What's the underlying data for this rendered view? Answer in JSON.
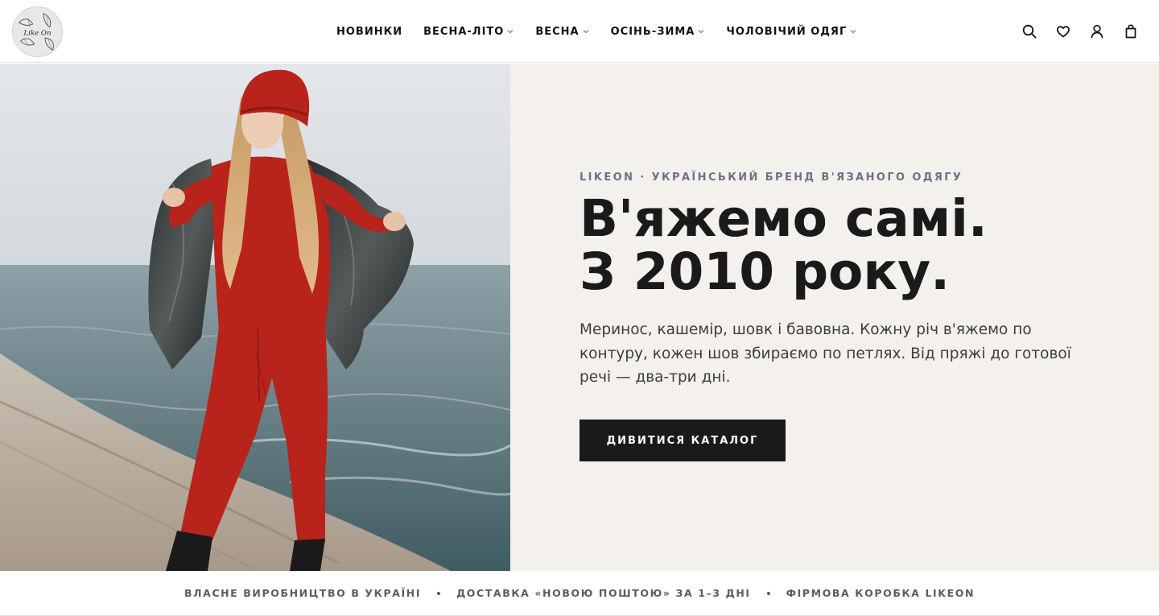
{
  "header": {
    "logo_text": "Like On",
    "nav": [
      {
        "label": "НОВИНКИ",
        "has_dropdown": false
      },
      {
        "label": "ВЕСНА-ЛІТО",
        "has_dropdown": true
      },
      {
        "label": "ВЕСНА",
        "has_dropdown": true
      },
      {
        "label": "ОСІНЬ-ЗИМА",
        "has_dropdown": true
      },
      {
        "label": "ЧОЛОВІЧИЙ ОДЯГ",
        "has_dropdown": true
      }
    ],
    "tools": [
      "search-icon",
      "heart-icon",
      "user-icon",
      "bag-icon"
    ]
  },
  "hero": {
    "eyebrow": "LIKEON · УКРАЇНСЬКИЙ БРЕНД В'ЯЗАНОГО ОДЯГУ",
    "headline_line1": "В'яжемо самі.",
    "headline_line2": "З 2010 року.",
    "lede": "Меринос, кашемір, шовк і бавовна. Кожну річ в'яжемо по контуру, кожен шов збираємо по петлях. Від пряжі до готової речі — два-три дні.",
    "cta_label": "ДИВИТИСЯ КАТАЛОГ",
    "panel_color": "#f4f1ec",
    "accent_color": "#b8231c"
  },
  "trust_bar": {
    "items": [
      "ВЛАСНЕ ВИРОБНИЦТВО В УКРАЇНІ",
      "ДОСТАВКА «НОВОЮ ПОШТОЮ» ЗА 1–3 ДНІ",
      "ФІРМОВА КОРОБКА LIKEON"
    ]
  }
}
